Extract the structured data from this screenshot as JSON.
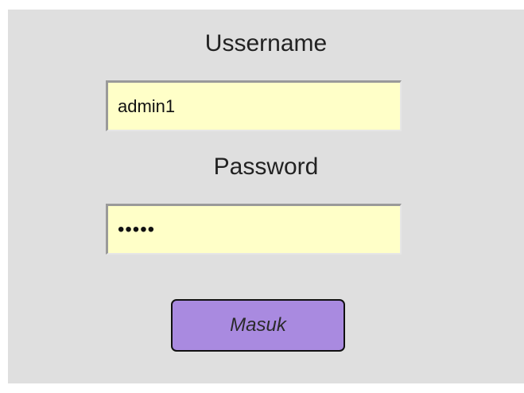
{
  "login_form": {
    "username_label": "Ussername",
    "username_value": "admin1",
    "password_label": "Password",
    "password_value": "admin",
    "submit_label": "Masuk"
  },
  "colors": {
    "panel_background": "#dfdfdf",
    "input_background": "#ffffc8",
    "button_background": "#a98ae0"
  }
}
